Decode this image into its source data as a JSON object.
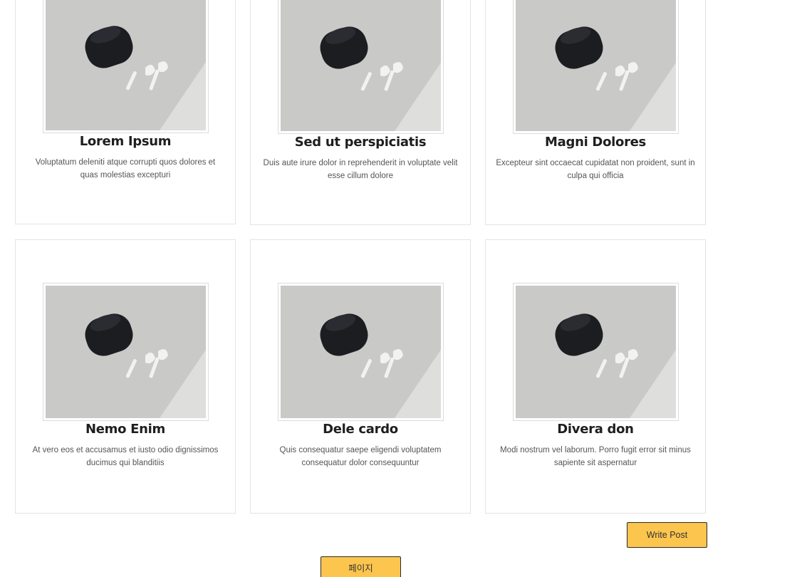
{
  "posts": [
    {
      "title": "Lorem Ipsum",
      "desc": "Voluptatum deleniti atque corrupti quos dolores et quas molestias excepturi",
      "image": "airpods-photo"
    },
    {
      "title": "Sed ut perspiciatis",
      "desc": "Duis aute irure dolor in reprehenderit in voluptate velit esse cillum dolore",
      "image": "airpods-photo"
    },
    {
      "title": "Magni Dolores",
      "desc": "Excepteur sint occaecat cupidatat non proident, sunt in culpa qui officia",
      "image": "airpods-photo"
    },
    {
      "title": "Nemo Enim",
      "desc": "At vero eos et accusamus et iusto odio dignissimos ducimus qui blanditiis",
      "image": "airpods-photo"
    },
    {
      "title": "Dele cardo",
      "desc": "Quis consequatur saepe eligendi voluptatem consequatur dolor consequuntur",
      "image": "airpods-photo"
    },
    {
      "title": "Divera don",
      "desc": "Modi nostrum vel laborum. Porro fugit error sit minus sapiente sit aspernatur",
      "image": "airpods-photo"
    }
  ],
  "actions": {
    "write_label": "Write Post",
    "page_label": "페이지"
  },
  "colors": {
    "button_accent": "#fcc54e",
    "card_border": "#e3e3e3"
  }
}
